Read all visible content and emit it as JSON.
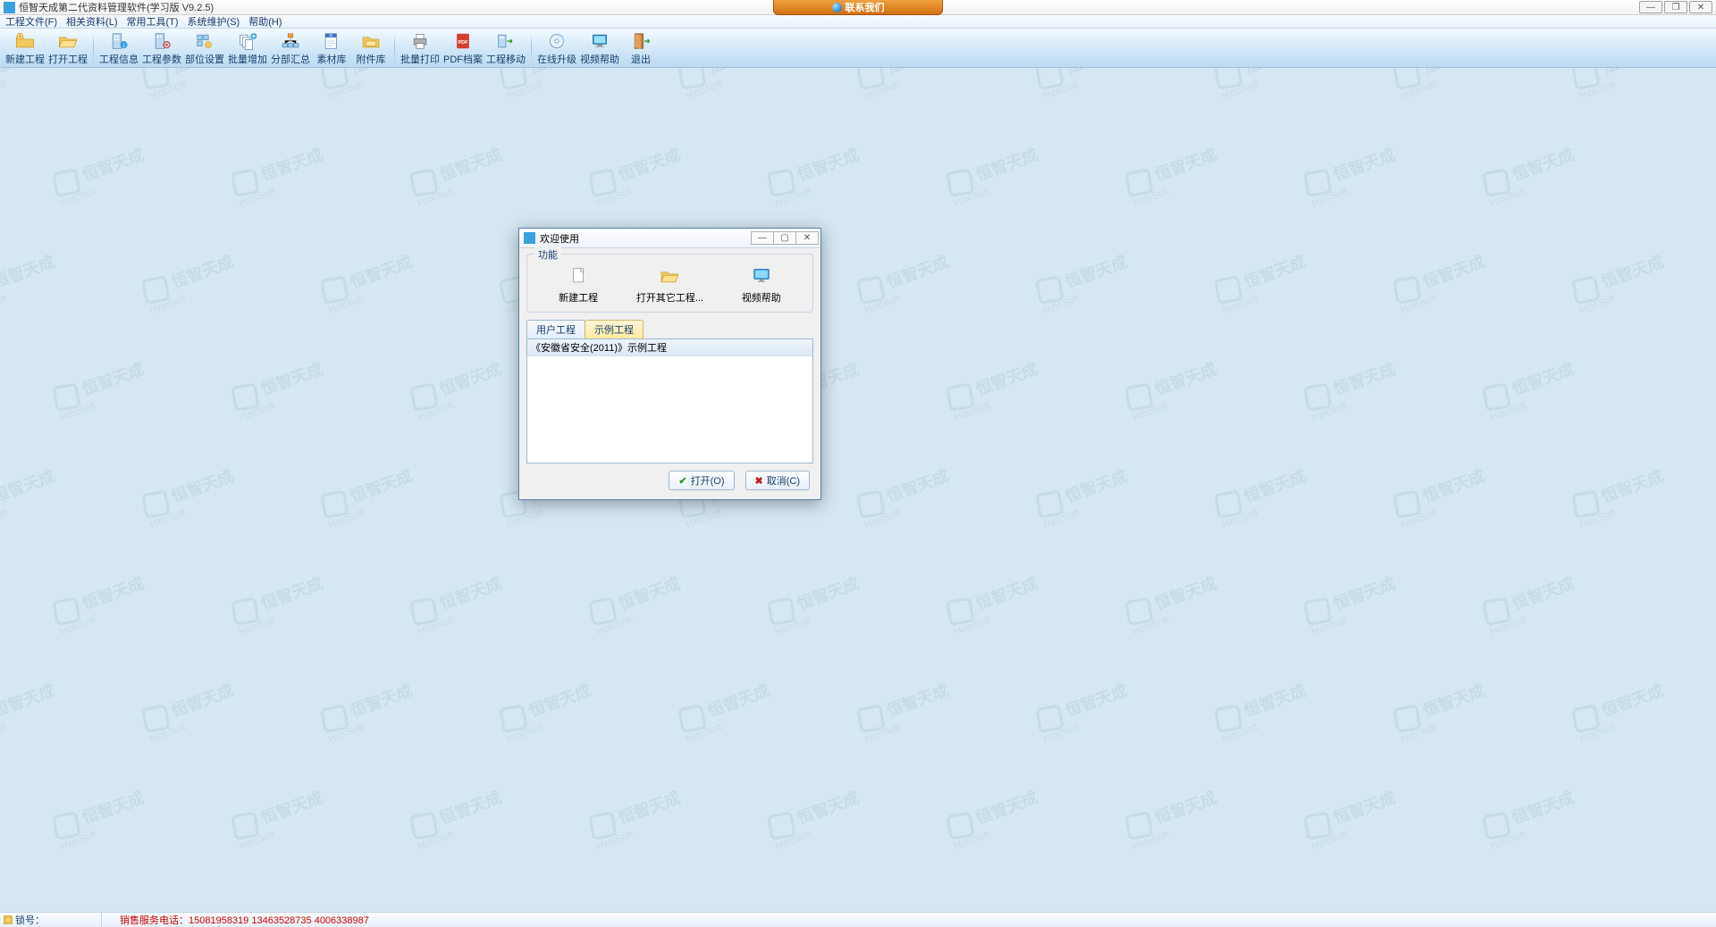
{
  "app": {
    "title": "恒智天成第二代资料管理软件(学习版 V9.2.5)",
    "contact_label": "联系我们"
  },
  "menubar": {
    "items": [
      "工程文件(F)",
      "相关资料(L)",
      "常用工具(T)",
      "系统维护(S)",
      "帮助(H)"
    ]
  },
  "toolbar": {
    "groups": [
      [
        {
          "id": "new-project",
          "label": "新建工程",
          "icon": "folder-new"
        },
        {
          "id": "open-project",
          "label": "打开工程",
          "icon": "folder-open"
        }
      ],
      [
        {
          "id": "project-info",
          "label": "工程信息",
          "icon": "building-info"
        },
        {
          "id": "project-params",
          "label": "工程参数",
          "icon": "building-gear"
        },
        {
          "id": "unit-settings",
          "label": "部位设置",
          "icon": "grid-settings"
        },
        {
          "id": "batch-add",
          "label": "批量增加",
          "icon": "docs-plus"
        },
        {
          "id": "section-summary",
          "label": "分部汇总",
          "icon": "hierarchy"
        },
        {
          "id": "material-lib",
          "label": "素材库",
          "icon": "doc-w"
        },
        {
          "id": "attachment-lib",
          "label": "附件库",
          "icon": "folder-lib"
        }
      ],
      [
        {
          "id": "batch-print",
          "label": "批量打印",
          "icon": "printer"
        },
        {
          "id": "pdf-archive",
          "label": "PDF档案",
          "icon": "pdf"
        },
        {
          "id": "project-move",
          "label": "工程移动",
          "icon": "building-move"
        }
      ],
      [
        {
          "id": "online-upgrade",
          "label": "在线升级",
          "icon": "disc"
        },
        {
          "id": "video-help",
          "label": "视频帮助",
          "icon": "monitor"
        },
        {
          "id": "exit",
          "label": "退出",
          "icon": "exit-door"
        }
      ]
    ]
  },
  "dialog": {
    "title": "欢迎使用",
    "groupbox_title": "功能",
    "functions": [
      {
        "id": "fn-new",
        "label": "新建工程",
        "icon": "file-new"
      },
      {
        "id": "fn-open",
        "label": "打开其它工程...",
        "icon": "folder-open-y"
      },
      {
        "id": "fn-video",
        "label": "视频帮助",
        "icon": "monitor-big"
      }
    ],
    "tabs": [
      {
        "id": "tab-user",
        "label": "用户工程",
        "active": false
      },
      {
        "id": "tab-sample",
        "label": "示例工程",
        "active": true
      }
    ],
    "list_items": [
      "《安徽省安全(2011)》示例工程"
    ],
    "buttons": {
      "open": "打开(O)",
      "cancel": "取消(C)"
    }
  },
  "statusbar": {
    "lock_label": "锁号：",
    "sales_label": "销售服务电话：",
    "sales_numbers": "15081958319 13463528735 4006338987"
  },
  "watermark": {
    "brand": "恒智天成",
    "sub": "HztcSoft"
  }
}
